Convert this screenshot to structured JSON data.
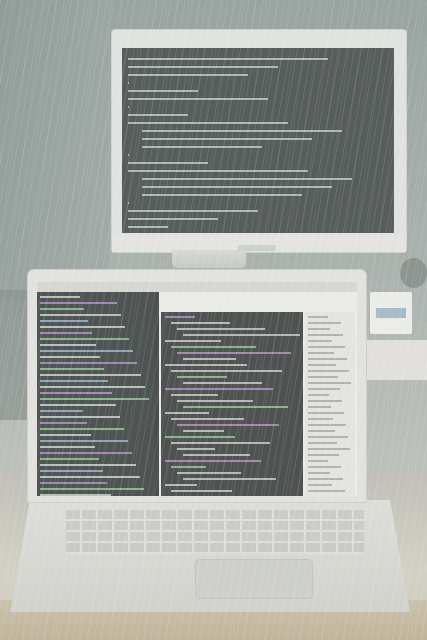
{
  "scene": {
    "description_free": true,
    "colors": {
      "monitor_bezel": "#e6e7e4",
      "terminal_bg": "#3f4543",
      "laptop_body": "#e7e7e2",
      "editor_bg": "#343836",
      "accent_blue": "#7f9ab5",
      "syntax_purple": "#b58ad0",
      "syntax_green": "#8fcf8f"
    }
  }
}
